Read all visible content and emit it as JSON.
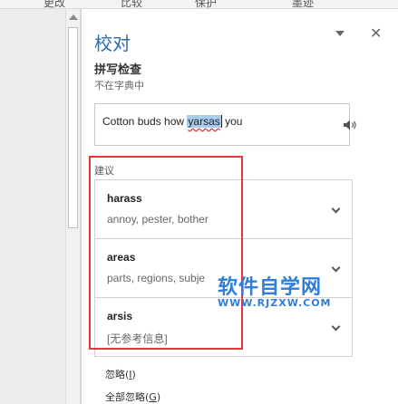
{
  "ribbon": {
    "tabs": [
      "更改",
      "比较",
      "保护",
      "墨迹"
    ]
  },
  "pane": {
    "title": "校对",
    "menu_icon": "chevron-down-icon",
    "close_icon": "close-icon",
    "close_glyph": "✕"
  },
  "spelling": {
    "heading": "拼写检查",
    "status": "不在字典中",
    "sentence_before": "Cotton buds how ",
    "sentence_error": "yarsas",
    "sentence_after": " you",
    "speaker_icon": "speaker-icon"
  },
  "suggestions": {
    "label": "建议",
    "items": [
      {
        "word": "harass",
        "synonyms": "annoy, pester, bother"
      },
      {
        "word": "areas",
        "synonyms": "parts, regions, subje"
      },
      {
        "word": "arsis",
        "synonyms": "[无参考信息]"
      }
    ]
  },
  "actions": {
    "ignore_label": "忽略(",
    "ignore_key": "I",
    "ignore_end": ")",
    "ignore_all_label": "全部忽略(",
    "ignore_all_key": "G",
    "ignore_all_end": ")"
  },
  "watermark": {
    "main": "软件自学网",
    "sub": "WWW.RJZXW.COM"
  },
  "colors": {
    "title": "#2b6cb0",
    "highlight": "#a9cdee",
    "annotation_box": "#e8353a",
    "watermark": "#2f7fd6"
  }
}
